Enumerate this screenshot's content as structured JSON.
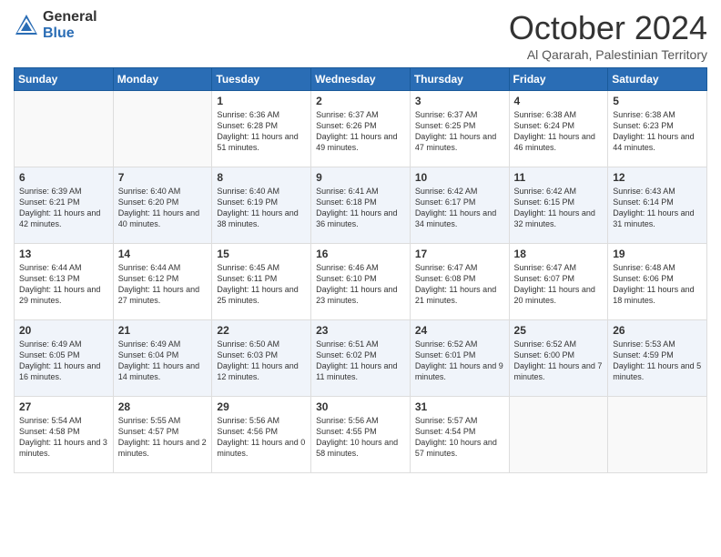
{
  "header": {
    "logo_general": "General",
    "logo_blue": "Blue",
    "month": "October 2024",
    "location": "Al Qararah, Palestinian Territory"
  },
  "weekdays": [
    "Sunday",
    "Monday",
    "Tuesday",
    "Wednesday",
    "Thursday",
    "Friday",
    "Saturday"
  ],
  "weeks": [
    [
      {
        "day": "",
        "info": ""
      },
      {
        "day": "",
        "info": ""
      },
      {
        "day": "1",
        "info": "Sunrise: 6:36 AM\nSunset: 6:28 PM\nDaylight: 11 hours and 51 minutes."
      },
      {
        "day": "2",
        "info": "Sunrise: 6:37 AM\nSunset: 6:26 PM\nDaylight: 11 hours and 49 minutes."
      },
      {
        "day": "3",
        "info": "Sunrise: 6:37 AM\nSunset: 6:25 PM\nDaylight: 11 hours and 47 minutes."
      },
      {
        "day": "4",
        "info": "Sunrise: 6:38 AM\nSunset: 6:24 PM\nDaylight: 11 hours and 46 minutes."
      },
      {
        "day": "5",
        "info": "Sunrise: 6:38 AM\nSunset: 6:23 PM\nDaylight: 11 hours and 44 minutes."
      }
    ],
    [
      {
        "day": "6",
        "info": "Sunrise: 6:39 AM\nSunset: 6:21 PM\nDaylight: 11 hours and 42 minutes."
      },
      {
        "day": "7",
        "info": "Sunrise: 6:40 AM\nSunset: 6:20 PM\nDaylight: 11 hours and 40 minutes."
      },
      {
        "day": "8",
        "info": "Sunrise: 6:40 AM\nSunset: 6:19 PM\nDaylight: 11 hours and 38 minutes."
      },
      {
        "day": "9",
        "info": "Sunrise: 6:41 AM\nSunset: 6:18 PM\nDaylight: 11 hours and 36 minutes."
      },
      {
        "day": "10",
        "info": "Sunrise: 6:42 AM\nSunset: 6:17 PM\nDaylight: 11 hours and 34 minutes."
      },
      {
        "day": "11",
        "info": "Sunrise: 6:42 AM\nSunset: 6:15 PM\nDaylight: 11 hours and 32 minutes."
      },
      {
        "day": "12",
        "info": "Sunrise: 6:43 AM\nSunset: 6:14 PM\nDaylight: 11 hours and 31 minutes."
      }
    ],
    [
      {
        "day": "13",
        "info": "Sunrise: 6:44 AM\nSunset: 6:13 PM\nDaylight: 11 hours and 29 minutes."
      },
      {
        "day": "14",
        "info": "Sunrise: 6:44 AM\nSunset: 6:12 PM\nDaylight: 11 hours and 27 minutes."
      },
      {
        "day": "15",
        "info": "Sunrise: 6:45 AM\nSunset: 6:11 PM\nDaylight: 11 hours and 25 minutes."
      },
      {
        "day": "16",
        "info": "Sunrise: 6:46 AM\nSunset: 6:10 PM\nDaylight: 11 hours and 23 minutes."
      },
      {
        "day": "17",
        "info": "Sunrise: 6:47 AM\nSunset: 6:08 PM\nDaylight: 11 hours and 21 minutes."
      },
      {
        "day": "18",
        "info": "Sunrise: 6:47 AM\nSunset: 6:07 PM\nDaylight: 11 hours and 20 minutes."
      },
      {
        "day": "19",
        "info": "Sunrise: 6:48 AM\nSunset: 6:06 PM\nDaylight: 11 hours and 18 minutes."
      }
    ],
    [
      {
        "day": "20",
        "info": "Sunrise: 6:49 AM\nSunset: 6:05 PM\nDaylight: 11 hours and 16 minutes."
      },
      {
        "day": "21",
        "info": "Sunrise: 6:49 AM\nSunset: 6:04 PM\nDaylight: 11 hours and 14 minutes."
      },
      {
        "day": "22",
        "info": "Sunrise: 6:50 AM\nSunset: 6:03 PM\nDaylight: 11 hours and 12 minutes."
      },
      {
        "day": "23",
        "info": "Sunrise: 6:51 AM\nSunset: 6:02 PM\nDaylight: 11 hours and 11 minutes."
      },
      {
        "day": "24",
        "info": "Sunrise: 6:52 AM\nSunset: 6:01 PM\nDaylight: 11 hours and 9 minutes."
      },
      {
        "day": "25",
        "info": "Sunrise: 6:52 AM\nSunset: 6:00 PM\nDaylight: 11 hours and 7 minutes."
      },
      {
        "day": "26",
        "info": "Sunrise: 5:53 AM\nSunset: 4:59 PM\nDaylight: 11 hours and 5 minutes."
      }
    ],
    [
      {
        "day": "27",
        "info": "Sunrise: 5:54 AM\nSunset: 4:58 PM\nDaylight: 11 hours and 3 minutes."
      },
      {
        "day": "28",
        "info": "Sunrise: 5:55 AM\nSunset: 4:57 PM\nDaylight: 11 hours and 2 minutes."
      },
      {
        "day": "29",
        "info": "Sunrise: 5:56 AM\nSunset: 4:56 PM\nDaylight: 11 hours and 0 minutes."
      },
      {
        "day": "30",
        "info": "Sunrise: 5:56 AM\nSunset: 4:55 PM\nDaylight: 10 hours and 58 minutes."
      },
      {
        "day": "31",
        "info": "Sunrise: 5:57 AM\nSunset: 4:54 PM\nDaylight: 10 hours and 57 minutes."
      },
      {
        "day": "",
        "info": ""
      },
      {
        "day": "",
        "info": ""
      }
    ]
  ]
}
